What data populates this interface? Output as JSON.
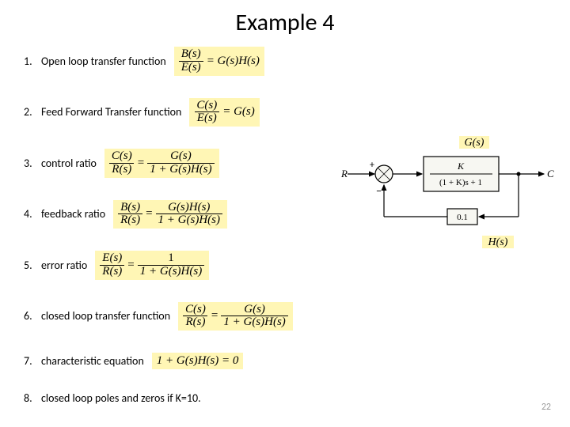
{
  "title": "Example 4",
  "page_number": "22",
  "items": [
    {
      "label": "Open loop transfer function",
      "lhs_num": "B(s)",
      "lhs_den": "E(s)",
      "rhs": "= G(s)H(s)"
    },
    {
      "label": "Feed Forward Transfer function",
      "lhs_num": "C(s)",
      "lhs_den": "E(s)",
      "rhs": "= G(s)"
    },
    {
      "label": "control ratio",
      "lhs_num": "C(s)",
      "lhs_den": "R(s)",
      "eq": "=",
      "rhs_num": "G(s)",
      "rhs_den": "1 + G(s)H(s)"
    },
    {
      "label": "feedback ratio",
      "lhs_num": "B(s)",
      "lhs_den": "R(s)",
      "eq": "=",
      "rhs_num": "G(s)H(s)",
      "rhs_den": "1 + G(s)H(s)"
    },
    {
      "label": "error ratio",
      "lhs_num": "E(s)",
      "lhs_den": "R(s)",
      "eq": "=",
      "rhs_num": "1",
      "rhs_den": "1 + G(s)H(s)"
    },
    {
      "label": "closed loop transfer function",
      "lhs_num": "C(s)",
      "lhs_den": "R(s)",
      "eq": "=",
      "rhs_num": "G(s)",
      "rhs_den": "1 + G(s)H(s)"
    },
    {
      "label": "characteristic equation",
      "single": "1 + G(s)H(s) = 0"
    },
    {
      "label": "closed loop poles and zeros if K=10."
    }
  ],
  "diagram": {
    "g_label": "G(s)",
    "h_label": "H(s)",
    "input": "R",
    "output": "C",
    "plus": "+",
    "minus": "−",
    "g_num": "K",
    "g_den": "(1 + K)s + 1",
    "h_val": "0.1"
  }
}
